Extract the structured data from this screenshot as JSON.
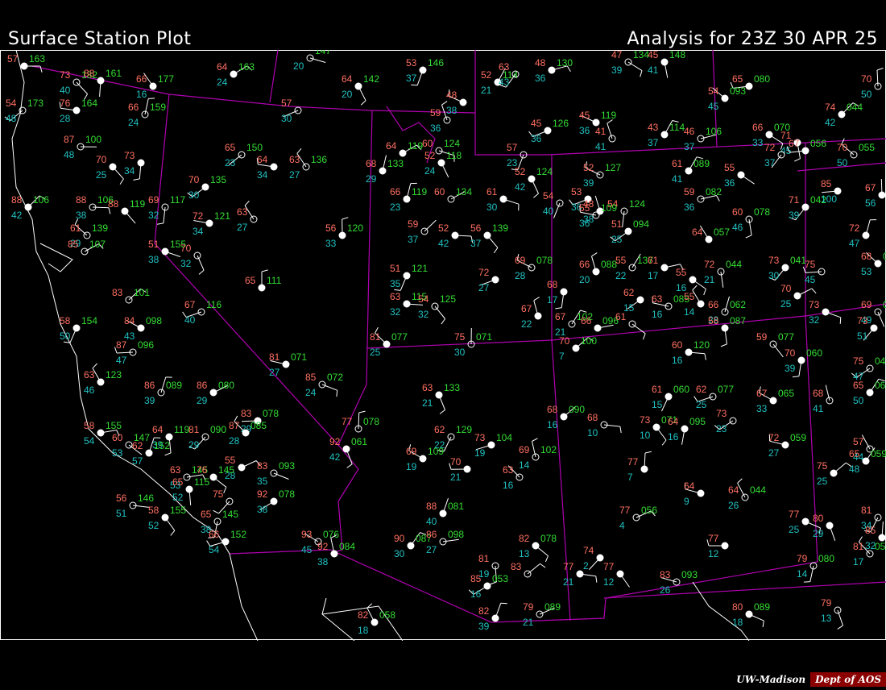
{
  "header": {
    "title": "Surface Station Plot",
    "analysis": "Analysis for 23Z 30 APR 25"
  },
  "credit": {
    "org": "UW-Madison",
    "dept": "Dept of AOS"
  },
  "colors": {
    "background": "#000000",
    "temperature": "#ff6f61",
    "dewpoint": "#20c0c0",
    "pressure": "#33dd33",
    "state_borders": "#b000b0",
    "coastline": "#ffffff",
    "station": "#ffffff"
  },
  "stations": [
    {
      "t": "57",
      "td": "",
      "p": "163"
    },
    {
      "t": "73",
      "td": "40",
      "p": "182"
    },
    {
      "t": "88",
      "td": "",
      "p": "161"
    },
    {
      "t": "54",
      "td": "48",
      "p": "173"
    },
    {
      "t": "76",
      "td": "28",
      "p": "164"
    },
    {
      "t": "66",
      "td": "16",
      "p": "177"
    },
    {
      "t": "66",
      "td": "24",
      "p": "159"
    },
    {
      "t": "64",
      "td": "24",
      "p": "163"
    },
    {
      "t": "",
      "td": "20",
      "p": "147"
    },
    {
      "t": "64",
      "td": "20",
      "p": "142"
    },
    {
      "t": "53",
      "td": "37",
      "p": "146"
    },
    {
      "t": "57",
      "td": "30",
      "p": ""
    },
    {
      "t": "48",
      "td": "38",
      "p": ""
    },
    {
      "t": "59",
      "td": "36",
      "p": ""
    },
    {
      "t": "52",
      "td": "21",
      "p": "114"
    },
    {
      "t": "48",
      "td": "36",
      "p": "130"
    },
    {
      "t": "47",
      "td": "39",
      "p": "134"
    },
    {
      "t": "45",
      "td": "41",
      "p": "148"
    },
    {
      "t": "63",
      "td": "43",
      "p": ""
    },
    {
      "t": "65",
      "td": "",
      "p": "080"
    },
    {
      "t": "54",
      "td": "45",
      "p": "093"
    },
    {
      "t": "70",
      "td": "50",
      "p": ""
    },
    {
      "t": "74",
      "td": "42",
      "p": "044"
    },
    {
      "t": "87",
      "td": "48",
      "p": "100"
    },
    {
      "t": "70",
      "td": "25",
      "p": ""
    },
    {
      "t": "73",
      "td": "34",
      "p": ""
    },
    {
      "t": "65",
      "td": "23",
      "p": "150"
    },
    {
      "t": "64",
      "td": "34",
      "p": ""
    },
    {
      "t": "63",
      "td": "27",
      "p": "136"
    },
    {
      "t": "68",
      "td": "29",
      "p": "133"
    },
    {
      "t": "64",
      "td": "",
      "p": "119"
    },
    {
      "t": "60",
      "td": "",
      "p": "124"
    },
    {
      "t": "52",
      "td": "24",
      "p": "118"
    },
    {
      "t": "57",
      "td": "23",
      "p": ""
    },
    {
      "t": "45",
      "td": "36",
      "p": "126"
    },
    {
      "t": "45",
      "td": "36",
      "p": "119"
    },
    {
      "t": "41",
      "td": "41",
      "p": ""
    },
    {
      "t": "43",
      "td": "37",
      "p": "114"
    },
    {
      "t": "46",
      "td": "37",
      "p": "106"
    },
    {
      "t": "66",
      "td": "33",
      "p": "070"
    },
    {
      "t": "71",
      "td": "45",
      "p": ""
    },
    {
      "t": "72",
      "td": "37",
      "p": ""
    },
    {
      "t": "67",
      "td": "",
      "p": "056"
    },
    {
      "t": "70",
      "td": "50",
      "p": "055"
    },
    {
      "t": "67",
      "td": "56",
      "p": ""
    },
    {
      "t": "88",
      "td": "42",
      "p": "106"
    },
    {
      "t": "88",
      "td": "38",
      "p": "106"
    },
    {
      "t": "88",
      "td": "",
      "p": "119"
    },
    {
      "t": "69",
      "td": "32",
      "p": "117"
    },
    {
      "t": "70",
      "td": "30",
      "p": "135"
    },
    {
      "t": "72",
      "td": "34",
      "p": "121"
    },
    {
      "t": "63",
      "td": "27",
      "p": ""
    },
    {
      "t": "66",
      "td": "23",
      "p": "119"
    },
    {
      "t": "60",
      "td": "",
      "p": "134"
    },
    {
      "t": "61",
      "td": "30",
      "p": ""
    },
    {
      "t": "52",
      "td": "42",
      "p": "124"
    },
    {
      "t": "54",
      "td": "40",
      "p": ""
    },
    {
      "t": "53",
      "td": "36",
      "p": ""
    },
    {
      "t": "52",
      "td": "39",
      "p": "127"
    },
    {
      "t": "48",
      "td": "38",
      "p": ""
    },
    {
      "t": "61",
      "td": "41",
      "p": "089"
    },
    {
      "t": "59",
      "td": "36",
      "p": "082"
    },
    {
      "t": "55",
      "td": "36",
      "p": ""
    },
    {
      "t": "60",
      "td": "46",
      "p": "078"
    },
    {
      "t": "71",
      "td": "39",
      "p": "042"
    },
    {
      "t": "85",
      "td": "100",
      "p": ""
    },
    {
      "t": "61",
      "td": "29",
      "p": "139"
    },
    {
      "t": "56",
      "td": "33",
      "p": "120"
    },
    {
      "t": "59",
      "td": "37",
      "p": ""
    },
    {
      "t": "52",
      "td": "42",
      "p": ""
    },
    {
      "t": "56",
      "td": "37",
      "p": "139"
    },
    {
      "t": "54",
      "td": "",
      "p": "124"
    },
    {
      "t": "51",
      "td": "25",
      "p": "094"
    },
    {
      "t": "55",
      "td": "36",
      "p": "109"
    },
    {
      "t": "64",
      "td": "",
      "p": "057"
    },
    {
      "t": "72",
      "td": "47",
      "p": ""
    },
    {
      "t": "85",
      "td": "",
      "p": "107"
    },
    {
      "t": "51",
      "td": "38",
      "p": "155"
    },
    {
      "t": "70",
      "td": "32",
      "p": ""
    },
    {
      "t": "51",
      "td": "35",
      "p": "121"
    },
    {
      "t": "72",
      "td": "27",
      "p": ""
    },
    {
      "t": "69",
      "td": "28",
      "p": "078"
    },
    {
      "t": "66",
      "td": "20",
      "p": "088"
    },
    {
      "t": "55",
      "td": "22",
      "p": "137"
    },
    {
      "t": "61",
      "td": "17",
      "p": ""
    },
    {
      "t": "55",
      "td": "16",
      "p": ""
    },
    {
      "t": "72",
      "td": "21",
      "p": "044"
    },
    {
      "t": "73",
      "td": "30",
      "p": "041"
    },
    {
      "t": "75",
      "td": "45",
      "p": ""
    },
    {
      "t": "68",
      "td": "53",
      "p": "050"
    },
    {
      "t": "65",
      "td": "",
      "p": "111"
    },
    {
      "t": "83",
      "td": "",
      "p": "101"
    },
    {
      "t": "63",
      "td": "32",
      "p": "115"
    },
    {
      "t": "54",
      "td": "32",
      "p": "125"
    },
    {
      "t": "68",
      "td": "17",
      "p": ""
    },
    {
      "t": "62",
      "td": "15",
      "p": ""
    },
    {
      "t": "63",
      "td": "16",
      "p": "085"
    },
    {
      "t": "55",
      "td": "14",
      "p": ""
    },
    {
      "t": "66",
      "td": "28",
      "p": "062"
    },
    {
      "t": "70",
      "td": "25",
      "p": ""
    },
    {
      "t": "73",
      "td": "32",
      "p": ""
    },
    {
      "t": "69",
      "td": "49",
      "p": "050"
    },
    {
      "t": "58",
      "td": "50",
      "p": "154"
    },
    {
      "t": "67",
      "td": "40",
      "p": "116"
    },
    {
      "t": "84",
      "td": "43",
      "p": "098"
    },
    {
      "t": "67",
      "td": "22",
      "p": ""
    },
    {
      "t": "67",
      "td": "21",
      "p": "102"
    },
    {
      "t": "66",
      "td": "",
      "p": "096"
    },
    {
      "t": "61",
      "td": "",
      "p": ""
    },
    {
      "t": "58",
      "td": "",
      "p": "087"
    },
    {
      "t": "73",
      "td": "51",
      "p": ""
    },
    {
      "t": "87",
      "td": "47",
      "p": "096"
    },
    {
      "t": "81",
      "td": "25",
      "p": "077"
    },
    {
      "t": "75",
      "td": "30",
      "p": "071"
    },
    {
      "t": "70",
      "td": "7",
      "p": "100"
    },
    {
      "t": "60",
      "td": "16",
      "p": "120"
    },
    {
      "t": "59",
      "td": "",
      "p": "077"
    },
    {
      "t": "70",
      "td": "39",
      "p": "060"
    },
    {
      "t": "75",
      "td": "47",
      "p": "048"
    },
    {
      "t": "81",
      "td": "27",
      "p": "071"
    },
    {
      "t": "63",
      "td": "46",
      "p": "123"
    },
    {
      "t": "86",
      "td": "39",
      "p": "089"
    },
    {
      "t": "86",
      "td": "29",
      "p": "080"
    },
    {
      "t": "85",
      "td": "24",
      "p": "072"
    },
    {
      "t": "63",
      "td": "21",
      "p": "133"
    },
    {
      "t": "61",
      "td": "15",
      "p": "060"
    },
    {
      "t": "62",
      "td": "25",
      "p": "077"
    },
    {
      "t": "67",
      "td": "33",
      "p": "065"
    },
    {
      "t": "68",
      "td": "41",
      "p": ""
    },
    {
      "t": "65",
      "td": "50",
      "p": "060"
    },
    {
      "t": "58",
      "td": "54",
      "p": "155"
    },
    {
      "t": "60",
      "td": "53",
      "p": "147"
    },
    {
      "t": "64",
      "td": "39",
      "p": "119"
    },
    {
      "t": "81",
      "td": "29",
      "p": "090"
    },
    {
      "t": "83",
      "td": "29",
      "p": "078"
    },
    {
      "t": "87",
      "td": "28",
      "p": "085"
    },
    {
      "t": "77",
      "td": "",
      "p": "078"
    },
    {
      "t": "68",
      "td": "16",
      "p": "090"
    },
    {
      "t": "68",
      "td": "10",
      "p": ""
    },
    {
      "t": "73",
      "td": "10",
      "p": "071"
    },
    {
      "t": "64",
      "td": "16",
      "p": "095"
    },
    {
      "t": "73",
      "td": "23",
      "p": ""
    },
    {
      "t": "72",
      "td": "27",
      "p": "059"
    },
    {
      "t": "57",
      "td": "44",
      "p": ""
    },
    {
      "t": "62",
      "td": "57",
      "p": "152"
    },
    {
      "t": "55",
      "td": "28",
      "p": ""
    },
    {
      "t": "83",
      "td": "35",
      "p": "093"
    },
    {
      "t": "92",
      "td": "42",
      "p": "061"
    },
    {
      "t": "62",
      "td": "22",
      "p": "129"
    },
    {
      "t": "73",
      "td": "19",
      "p": "104"
    },
    {
      "t": "69",
      "td": "19",
      "p": "109"
    },
    {
      "t": "69",
      "td": "14",
      "p": "102"
    },
    {
      "t": "65",
      "td": "48",
      "p": "059"
    },
    {
      "t": "63",
      "td": "53",
      "p": "145"
    },
    {
      "t": "76",
      "td": "",
      "p": "145"
    },
    {
      "t": "65",
      "td": "52",
      "p": "115"
    },
    {
      "t": "75",
      "td": "",
      "p": ""
    },
    {
      "t": "70",
      "td": "21",
      "p": ""
    },
    {
      "t": "63",
      "td": "16",
      "p": ""
    },
    {
      "t": "77",
      "td": "7",
      "p": ""
    },
    {
      "t": "75",
      "td": "25",
      "p": ""
    },
    {
      "t": "56",
      "td": "51",
      "p": "146"
    },
    {
      "t": "58",
      "td": "52",
      "p": "155"
    },
    {
      "t": "65",
      "td": "38",
      "p": "145"
    },
    {
      "t": "92",
      "td": "38",
      "p": "078"
    },
    {
      "t": "64",
      "td": "9",
      "p": ""
    },
    {
      "t": "64",
      "td": "26",
      "p": "044"
    },
    {
      "t": "88",
      "td": "40",
      "p": "081"
    },
    {
      "t": "77",
      "td": "4",
      "p": "056"
    },
    {
      "t": "77",
      "td": "25",
      "p": ""
    },
    {
      "t": "80",
      "td": "29",
      "p": ""
    },
    {
      "t": "81",
      "td": "34",
      "p": ""
    },
    {
      "t": "66",
      "td": "54",
      "p": "152"
    },
    {
      "t": "93",
      "td": "45",
      "p": "076"
    },
    {
      "t": "92",
      "td": "38",
      "p": "084"
    },
    {
      "t": "90",
      "td": "30",
      "p": "087"
    },
    {
      "t": "86",
      "td": "27",
      "p": "098"
    },
    {
      "t": "82",
      "td": "13",
      "p": "078"
    },
    {
      "t": "81",
      "td": "19",
      "p": ""
    },
    {
      "t": "74",
      "td": "2",
      "p": ""
    },
    {
      "t": "77",
      "td": "12",
      "p": ""
    },
    {
      "t": "81",
      "td": "17",
      "p": "053"
    },
    {
      "t": "85",
      "td": "32",
      "p": "037"
    },
    {
      "t": "83",
      "td": "",
      "p": ""
    },
    {
      "t": "77",
      "td": "21",
      "p": ""
    },
    {
      "t": "77",
      "td": "12",
      "p": ""
    },
    {
      "t": "79",
      "td": "14",
      "p": "080"
    },
    {
      "t": "85",
      "td": "16",
      "p": "053"
    },
    {
      "t": "83",
      "td": "26",
      "p": "093"
    },
    {
      "t": "82",
      "td": "18",
      "p": "058"
    },
    {
      "t": "82",
      "td": "39",
      "p": ""
    },
    {
      "t": "79",
      "td": "21",
      "p": "089"
    },
    {
      "t": "80",
      "td": "18",
      "p": "089"
    },
    {
      "t": "79",
      "td": "13",
      "p": ""
    },
    {
      "t": "65",
      "td": "18",
      "p": "057"
    }
  ]
}
